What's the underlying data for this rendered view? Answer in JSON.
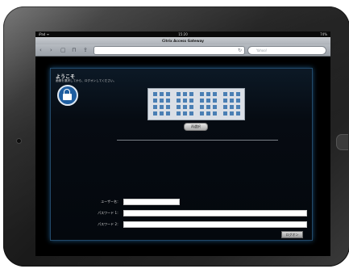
{
  "status_bar": {
    "carrier": "iPad ᯤ",
    "time": "15:20",
    "battery": "74%"
  },
  "browser": {
    "window_title": "Citrix Access Gateway",
    "url": "",
    "search_placeholder": "Yahoo!",
    "icons": [
      "back-icon",
      "forward-icon",
      "tabs-icon",
      "bookmarks-icon",
      "share-icon",
      "reload-icon",
      "search-icon"
    ]
  },
  "page": {
    "welcome": "ようこそ",
    "instruction": "画像を選択してから、ログオンしてください。",
    "image_grid": {
      "blocks": 4,
      "rows": 4,
      "cols": 3
    },
    "reset_button": "再選択",
    "form": [
      {
        "label": "ユーザー名：",
        "value": ""
      },
      {
        "label": "パスワード 1：",
        "value": ""
      },
      {
        "label": "パスワード 2：",
        "value": ""
      }
    ],
    "login_button": "ログオン"
  },
  "colors": {
    "panel_border": "#234a6a",
    "lock_blue": "#1f5ea0",
    "grid_cell": "#4a7fb4"
  }
}
